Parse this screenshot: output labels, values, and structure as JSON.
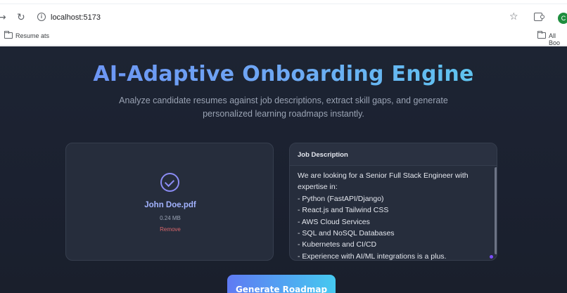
{
  "browser": {
    "url": "localhost:5173",
    "avatar_initial": "C",
    "bookmarks": [
      {
        "label": "Resume ats"
      },
      {
        "label": "All Boo"
      }
    ],
    "icons": [
      "forward-arrow-icon",
      "reload-icon",
      "site-info-icon",
      "bookmark-star-icon",
      "extensions-icon",
      "profile-avatar",
      "folder-icon"
    ]
  },
  "app": {
    "title": "AI-Adaptive Onboarding Engine",
    "subtitle": "Analyze candidate resumes against job descriptions, extract skill gaps, and generate personalized learning roadmaps instantly.",
    "upload": {
      "file_name": "John Doe.pdf",
      "file_size": "0.24 MB",
      "remove_label": "Remove",
      "status_icon": "check-circle-icon"
    },
    "job_description": {
      "label": "Job Description",
      "lines": [
        "We are looking for a Senior Full Stack Engineer with",
        "expertise in:",
        "- Python (FastAPI/Django)",
        "- React.js and Tailwind CSS",
        "- AWS Cloud Services",
        "- SQL and NoSQL Databases",
        "- Kubernetes and CI/CD",
        "- Experience with AI/ML integrations is a plus."
      ]
    },
    "generate_button": "Generate Roadmap",
    "colors": {
      "background": "#1d2433",
      "card": "#262d3c",
      "accent_start": "#5f7af3",
      "accent_end": "#45c9f0",
      "file_name": "#a3b3ff",
      "remove": "#d9666b"
    }
  }
}
